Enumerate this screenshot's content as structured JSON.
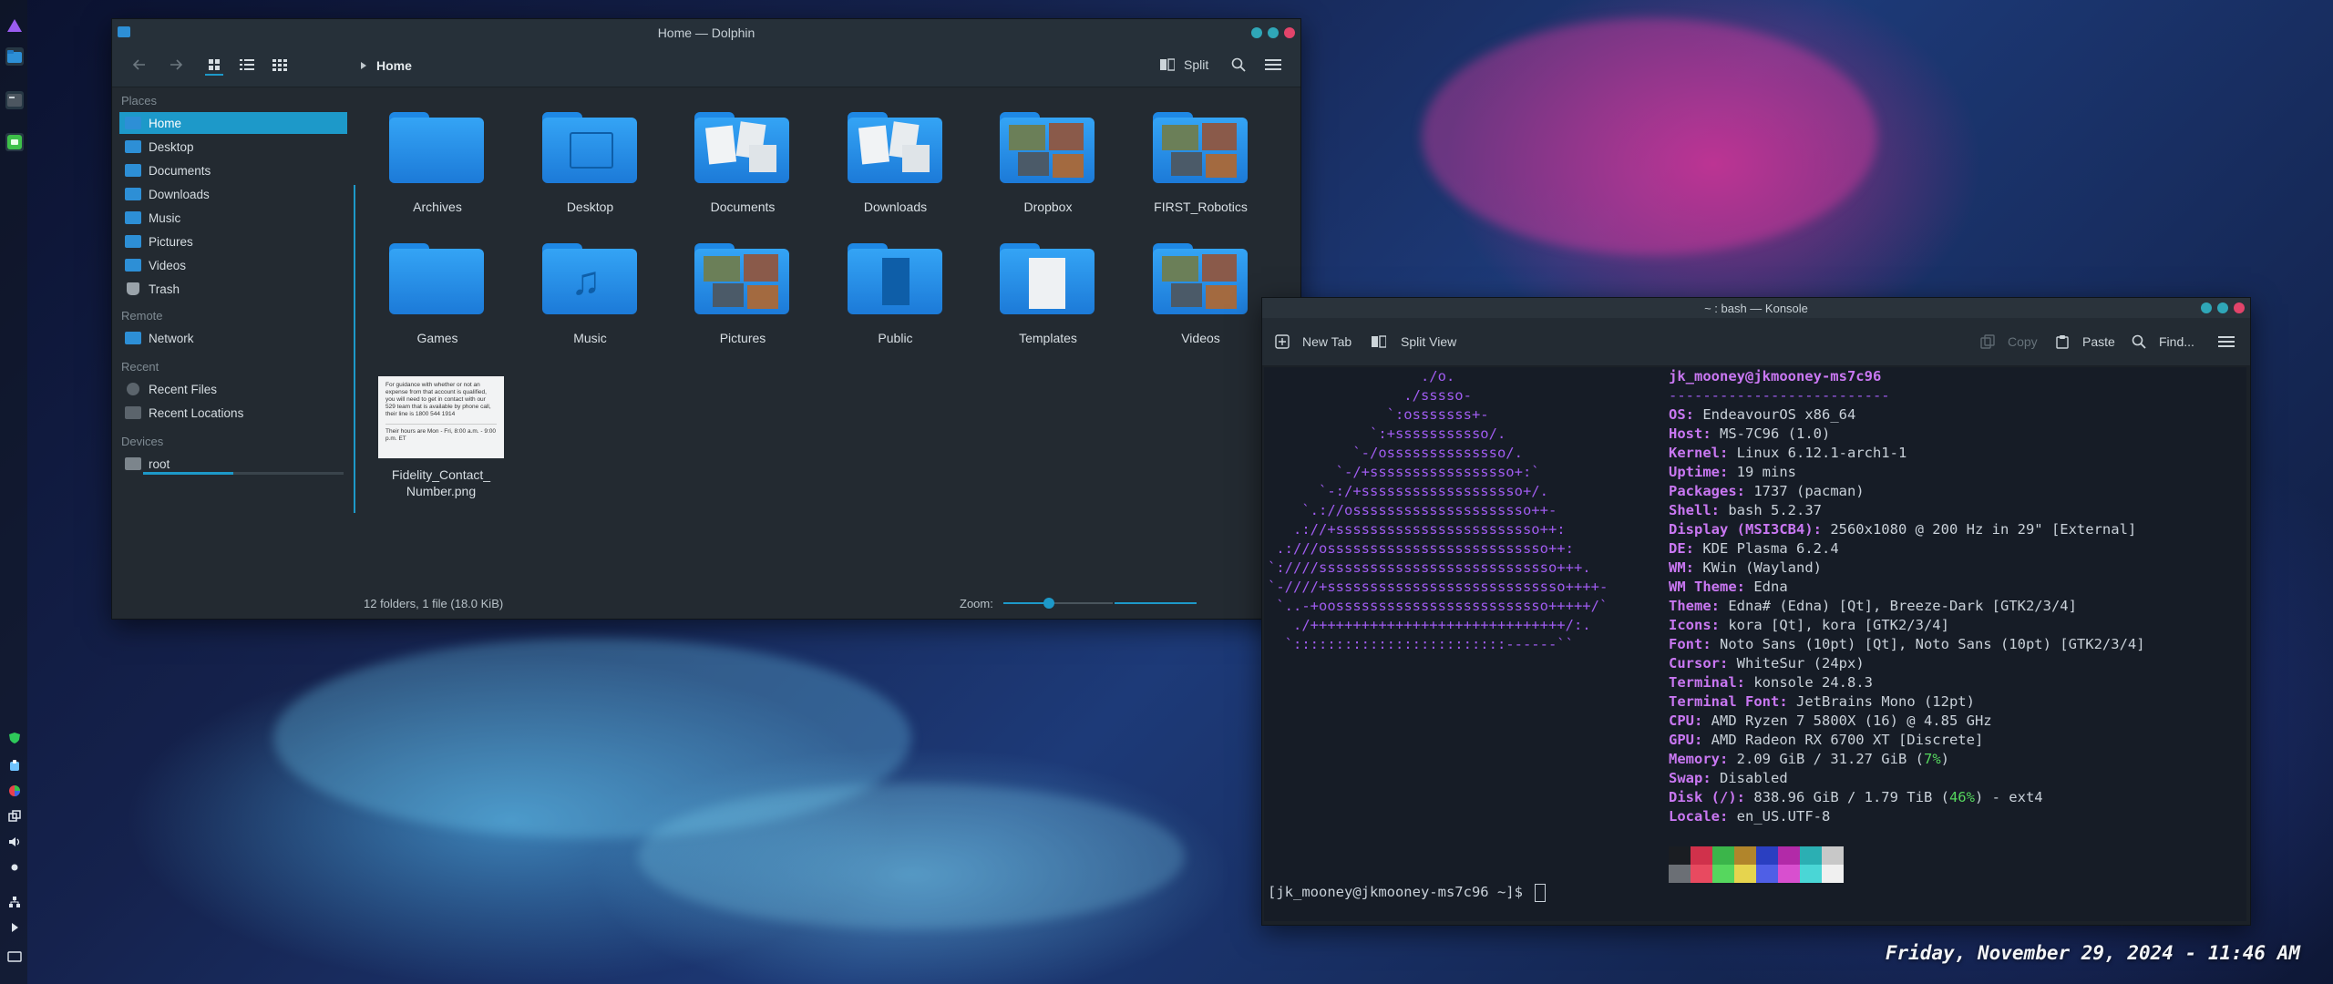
{
  "desktop": {
    "clock": "Friday, November 29, 2024 -  11:46 AM"
  },
  "dolphin": {
    "title": "Home — Dolphin",
    "breadcrumb": "Home",
    "split_label": "Split",
    "places": {
      "header_places": "Places",
      "items": [
        "Home",
        "Desktop",
        "Documents",
        "Downloads",
        "Music",
        "Pictures",
        "Videos",
        "Trash"
      ],
      "header_remote": "Remote",
      "remote_items": [
        "Network"
      ],
      "header_recent": "Recent",
      "recent_items": [
        "Recent Files",
        "Recent Locations"
      ],
      "header_devices": "Devices",
      "device_items": [
        "root"
      ],
      "root_usage": 0.45
    },
    "files": [
      {
        "name": "Archives"
      },
      {
        "name": "Desktop"
      },
      {
        "name": "Documents"
      },
      {
        "name": "Downloads"
      },
      {
        "name": "Dropbox"
      },
      {
        "name": "FIRST_Robotics"
      },
      {
        "name": "Games"
      },
      {
        "name": "Music"
      },
      {
        "name": "Pictures"
      },
      {
        "name": "Public"
      },
      {
        "name": "Templates"
      },
      {
        "name": "Videos"
      }
    ],
    "image_file": {
      "name_line1": "Fidelity_Contact_",
      "name_line2": "Number.png",
      "preview_text": "For guidance with whether or not an expense from that account is qualified, you will need to get in contact with our 529 team that is available by phone call, their line is 1800 544 1914",
      "preview_text2": "Their hours are Mon - Fri, 8:00 a.m. - 9:00 p.m. ET"
    },
    "status_text": "12 folders, 1 file (18.0 KiB)",
    "zoom_label": "Zoom:",
    "zoom_level": 0.42
  },
  "konsole": {
    "title": "~ : bash — Konsole",
    "new_tab": "New Tab",
    "split_view": "Split View",
    "copy": "Copy",
    "paste": "Paste",
    "find": "Find...",
    "logo_lines": [
      "                  ./o.",
      "                ./sssso-",
      "              `:osssssss+-",
      "            `:+sssssssssso/.",
      "          `-/ossssssssssssso/.",
      "        `-/+sssssssssssssssso+:`",
      "      `-:/+sssssssssssssssssso+/.",
      "    `.://osssssssssssssssssssso++-",
      "   .://+ssssssssssssssssssssssso++:",
      " .:///ossssssssssssssssssssssssso++:",
      "`:////ssssssssssssssssssssssssssso+++.",
      "`-////+ssssssssssssssssssssssssssso++++-",
      " `..-+oosssssssssssssssssssssssso+++++/`",
      "   ./++++++++++++++++++++++++++++++/:.",
      "  `:::::::::::::::::::::::::------``"
    ],
    "user_host": "jk_mooney@jkmooney-ms7c96",
    "separator": "--------------------------",
    "info": [
      {
        "key": "OS",
        "value": "EndeavourOS x86_64"
      },
      {
        "key": "Host",
        "value": "MS-7C96 (1.0)"
      },
      {
        "key": "Kernel",
        "value": "Linux 6.12.1-arch1-1"
      },
      {
        "key": "Uptime",
        "value": "19 mins"
      },
      {
        "key": "Packages",
        "value": "1737 (pacman)"
      },
      {
        "key": "Shell",
        "value": "bash 5.2.37"
      },
      {
        "key": "Display (MSI3CB4)",
        "value": "2560x1080 @ 200 Hz in 29\" [External]"
      },
      {
        "key": "DE",
        "value": "KDE Plasma 6.2.4"
      },
      {
        "key": "WM",
        "value": "KWin (Wayland)"
      },
      {
        "key": "WM Theme",
        "value": "Edna"
      },
      {
        "key": "Theme",
        "value": "Edna# (Edna) [Qt], Breeze-Dark [GTK2/3/4]"
      },
      {
        "key": "Icons",
        "value": "kora [Qt], kora [GTK2/3/4]"
      },
      {
        "key": "Font",
        "value": "Noto Sans (10pt) [Qt], Noto Sans (10pt) [GTK2/3/4]"
      },
      {
        "key": "Cursor",
        "value": "WhiteSur (24px)"
      },
      {
        "key": "Terminal",
        "value": "konsole 24.8.3"
      },
      {
        "key": "Terminal Font",
        "value": "JetBrains Mono (12pt)"
      },
      {
        "key": "CPU",
        "value": "AMD Ryzen 7 5800X (16) @ 4.85 GHz"
      },
      {
        "key": "GPU",
        "value": "AMD Radeon RX 6700 XT [Discrete]"
      },
      {
        "key": "Memory",
        "value": "2.09 GiB / 31.27 GiB (",
        "pct": "7%",
        "tail": ")"
      },
      {
        "key": "Swap",
        "value": "Disabled"
      },
      {
        "key": "Disk (/)",
        "value": "838.96 GiB / 1.79 TiB (",
        "pct": "46%",
        "tail": ") - ext4"
      },
      {
        "key": "Locale",
        "value": "en_US.UTF-8"
      }
    ],
    "palette_top": [
      "#1a1d22",
      "#d0314b",
      "#3bb54a",
      "#b1852b",
      "#2a3fc1",
      "#b22aa8",
      "#2bafb3",
      "#c8c8c8"
    ],
    "palette_bottom": [
      "#6b6f75",
      "#e84a60",
      "#56d75e",
      "#e6d44e",
      "#4f5fe6",
      "#d84fcf",
      "#4ad6d6",
      "#f0f0f0"
    ],
    "prompt": "[jk_mooney@jkmooney-ms7c96 ~]$ "
  },
  "colors": {
    "accent": "#1d99c9",
    "folder": "#2a96ea",
    "logo": "#a05cf0",
    "key": "#c977f2",
    "green": "#56d75e"
  }
}
